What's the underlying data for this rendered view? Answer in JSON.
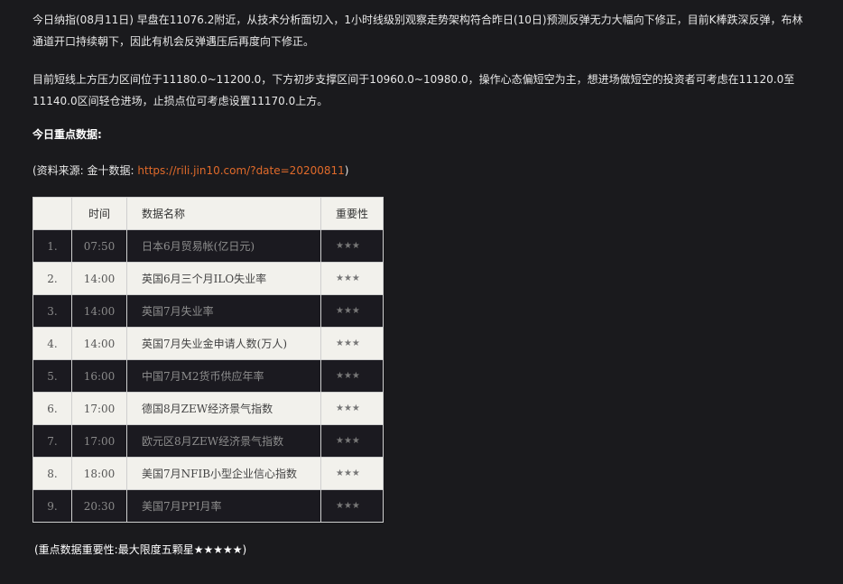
{
  "paragraphs": {
    "p1": "今日纳指(08月11日) 早盘在11076.2附近，从技术分析面切入，1小时线级别观察走势架构符合昨日(10日)预测反弹无力大幅向下修正，目前K棒跌深反弹，布林通道开口持续朝下，因此有机会反弹遇压后再度向下修正。",
    "p2": "目前短线上方压力区间位于11180.0~11200.0，下方初步支撑区间于10960.0~10980.0，操作心态偏短空为主，想进场做短空的投资者可考虑在11120.0至11140.0区间轻仓进场，止损点位可考虑设置11170.0上方。"
  },
  "heading": "今日重点数据:",
  "source": {
    "prefix": "(资料来源: 金十数据: ",
    "link": "https://rili.jin10.com/?date=20200811",
    "suffix": ")"
  },
  "table": {
    "headers": [
      "",
      "时间",
      "数据名称",
      "重要性"
    ],
    "rows": [
      {
        "no": "1.",
        "time": "07:50",
        "name": "日本6月贸易帐(亿日元)",
        "importance": "★★★"
      },
      {
        "no": "2.",
        "time": "14:00",
        "name": "英国6月三个月ILO失业率",
        "importance": "★★★"
      },
      {
        "no": "3.",
        "time": "14:00",
        "name": "英国7月失业率",
        "importance": "★★★"
      },
      {
        "no": "4.",
        "time": "14:00",
        "name": "英国7月失业金申请人数(万人)",
        "importance": "★★★"
      },
      {
        "no": "5.",
        "time": "16:00",
        "name": "中国7月M2货币供应年率",
        "importance": "★★★"
      },
      {
        "no": "6.",
        "time": "17:00",
        "name": "德国8月ZEW经济景气指数",
        "importance": "★★★"
      },
      {
        "no": "7.",
        "time": "17:00",
        "name": "欧元区8月ZEW经济景气指数",
        "importance": "★★★"
      },
      {
        "no": "8.",
        "time": "18:00",
        "name": "美国7月NFIB小型企业信心指数",
        "importance": "★★★"
      },
      {
        "no": "9.",
        "time": "20:30",
        "name": "美国7月PPI月率",
        "importance": "★★★"
      }
    ]
  },
  "note": "(重点数据重要性:最大限度五颗星★★★★★)",
  "colors": {
    "background": "#1a1a1d",
    "link": "#e06a2a",
    "row_light": "#f2f1ec",
    "row_dark": "#1b1a20"
  }
}
